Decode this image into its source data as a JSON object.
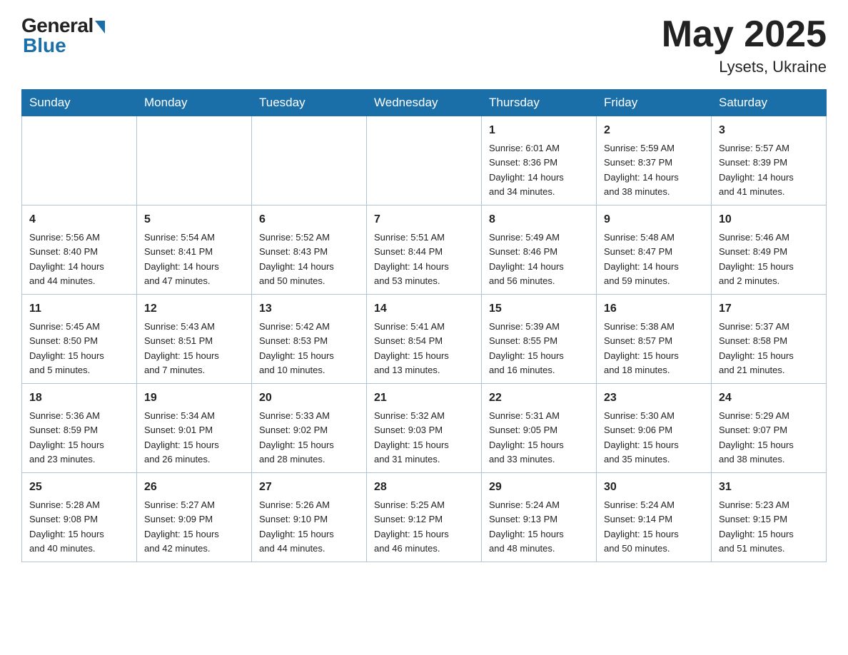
{
  "header": {
    "logo_general": "General",
    "logo_blue": "Blue",
    "title": "May 2025",
    "location": "Lysets, Ukraine"
  },
  "days_of_week": [
    "Sunday",
    "Monday",
    "Tuesday",
    "Wednesday",
    "Thursday",
    "Friday",
    "Saturday"
  ],
  "weeks": [
    [
      {
        "day": "",
        "info": ""
      },
      {
        "day": "",
        "info": ""
      },
      {
        "day": "",
        "info": ""
      },
      {
        "day": "",
        "info": ""
      },
      {
        "day": "1",
        "info": "Sunrise: 6:01 AM\nSunset: 8:36 PM\nDaylight: 14 hours\nand 34 minutes."
      },
      {
        "day": "2",
        "info": "Sunrise: 5:59 AM\nSunset: 8:37 PM\nDaylight: 14 hours\nand 38 minutes."
      },
      {
        "day": "3",
        "info": "Sunrise: 5:57 AM\nSunset: 8:39 PM\nDaylight: 14 hours\nand 41 minutes."
      }
    ],
    [
      {
        "day": "4",
        "info": "Sunrise: 5:56 AM\nSunset: 8:40 PM\nDaylight: 14 hours\nand 44 minutes."
      },
      {
        "day": "5",
        "info": "Sunrise: 5:54 AM\nSunset: 8:41 PM\nDaylight: 14 hours\nand 47 minutes."
      },
      {
        "day": "6",
        "info": "Sunrise: 5:52 AM\nSunset: 8:43 PM\nDaylight: 14 hours\nand 50 minutes."
      },
      {
        "day": "7",
        "info": "Sunrise: 5:51 AM\nSunset: 8:44 PM\nDaylight: 14 hours\nand 53 minutes."
      },
      {
        "day": "8",
        "info": "Sunrise: 5:49 AM\nSunset: 8:46 PM\nDaylight: 14 hours\nand 56 minutes."
      },
      {
        "day": "9",
        "info": "Sunrise: 5:48 AM\nSunset: 8:47 PM\nDaylight: 14 hours\nand 59 minutes."
      },
      {
        "day": "10",
        "info": "Sunrise: 5:46 AM\nSunset: 8:49 PM\nDaylight: 15 hours\nand 2 minutes."
      }
    ],
    [
      {
        "day": "11",
        "info": "Sunrise: 5:45 AM\nSunset: 8:50 PM\nDaylight: 15 hours\nand 5 minutes."
      },
      {
        "day": "12",
        "info": "Sunrise: 5:43 AM\nSunset: 8:51 PM\nDaylight: 15 hours\nand 7 minutes."
      },
      {
        "day": "13",
        "info": "Sunrise: 5:42 AM\nSunset: 8:53 PM\nDaylight: 15 hours\nand 10 minutes."
      },
      {
        "day": "14",
        "info": "Sunrise: 5:41 AM\nSunset: 8:54 PM\nDaylight: 15 hours\nand 13 minutes."
      },
      {
        "day": "15",
        "info": "Sunrise: 5:39 AM\nSunset: 8:55 PM\nDaylight: 15 hours\nand 16 minutes."
      },
      {
        "day": "16",
        "info": "Sunrise: 5:38 AM\nSunset: 8:57 PM\nDaylight: 15 hours\nand 18 minutes."
      },
      {
        "day": "17",
        "info": "Sunrise: 5:37 AM\nSunset: 8:58 PM\nDaylight: 15 hours\nand 21 minutes."
      }
    ],
    [
      {
        "day": "18",
        "info": "Sunrise: 5:36 AM\nSunset: 8:59 PM\nDaylight: 15 hours\nand 23 minutes."
      },
      {
        "day": "19",
        "info": "Sunrise: 5:34 AM\nSunset: 9:01 PM\nDaylight: 15 hours\nand 26 minutes."
      },
      {
        "day": "20",
        "info": "Sunrise: 5:33 AM\nSunset: 9:02 PM\nDaylight: 15 hours\nand 28 minutes."
      },
      {
        "day": "21",
        "info": "Sunrise: 5:32 AM\nSunset: 9:03 PM\nDaylight: 15 hours\nand 31 minutes."
      },
      {
        "day": "22",
        "info": "Sunrise: 5:31 AM\nSunset: 9:05 PM\nDaylight: 15 hours\nand 33 minutes."
      },
      {
        "day": "23",
        "info": "Sunrise: 5:30 AM\nSunset: 9:06 PM\nDaylight: 15 hours\nand 35 minutes."
      },
      {
        "day": "24",
        "info": "Sunrise: 5:29 AM\nSunset: 9:07 PM\nDaylight: 15 hours\nand 38 minutes."
      }
    ],
    [
      {
        "day": "25",
        "info": "Sunrise: 5:28 AM\nSunset: 9:08 PM\nDaylight: 15 hours\nand 40 minutes."
      },
      {
        "day": "26",
        "info": "Sunrise: 5:27 AM\nSunset: 9:09 PM\nDaylight: 15 hours\nand 42 minutes."
      },
      {
        "day": "27",
        "info": "Sunrise: 5:26 AM\nSunset: 9:10 PM\nDaylight: 15 hours\nand 44 minutes."
      },
      {
        "day": "28",
        "info": "Sunrise: 5:25 AM\nSunset: 9:12 PM\nDaylight: 15 hours\nand 46 minutes."
      },
      {
        "day": "29",
        "info": "Sunrise: 5:24 AM\nSunset: 9:13 PM\nDaylight: 15 hours\nand 48 minutes."
      },
      {
        "day": "30",
        "info": "Sunrise: 5:24 AM\nSunset: 9:14 PM\nDaylight: 15 hours\nand 50 minutes."
      },
      {
        "day": "31",
        "info": "Sunrise: 5:23 AM\nSunset: 9:15 PM\nDaylight: 15 hours\nand 51 minutes."
      }
    ]
  ]
}
